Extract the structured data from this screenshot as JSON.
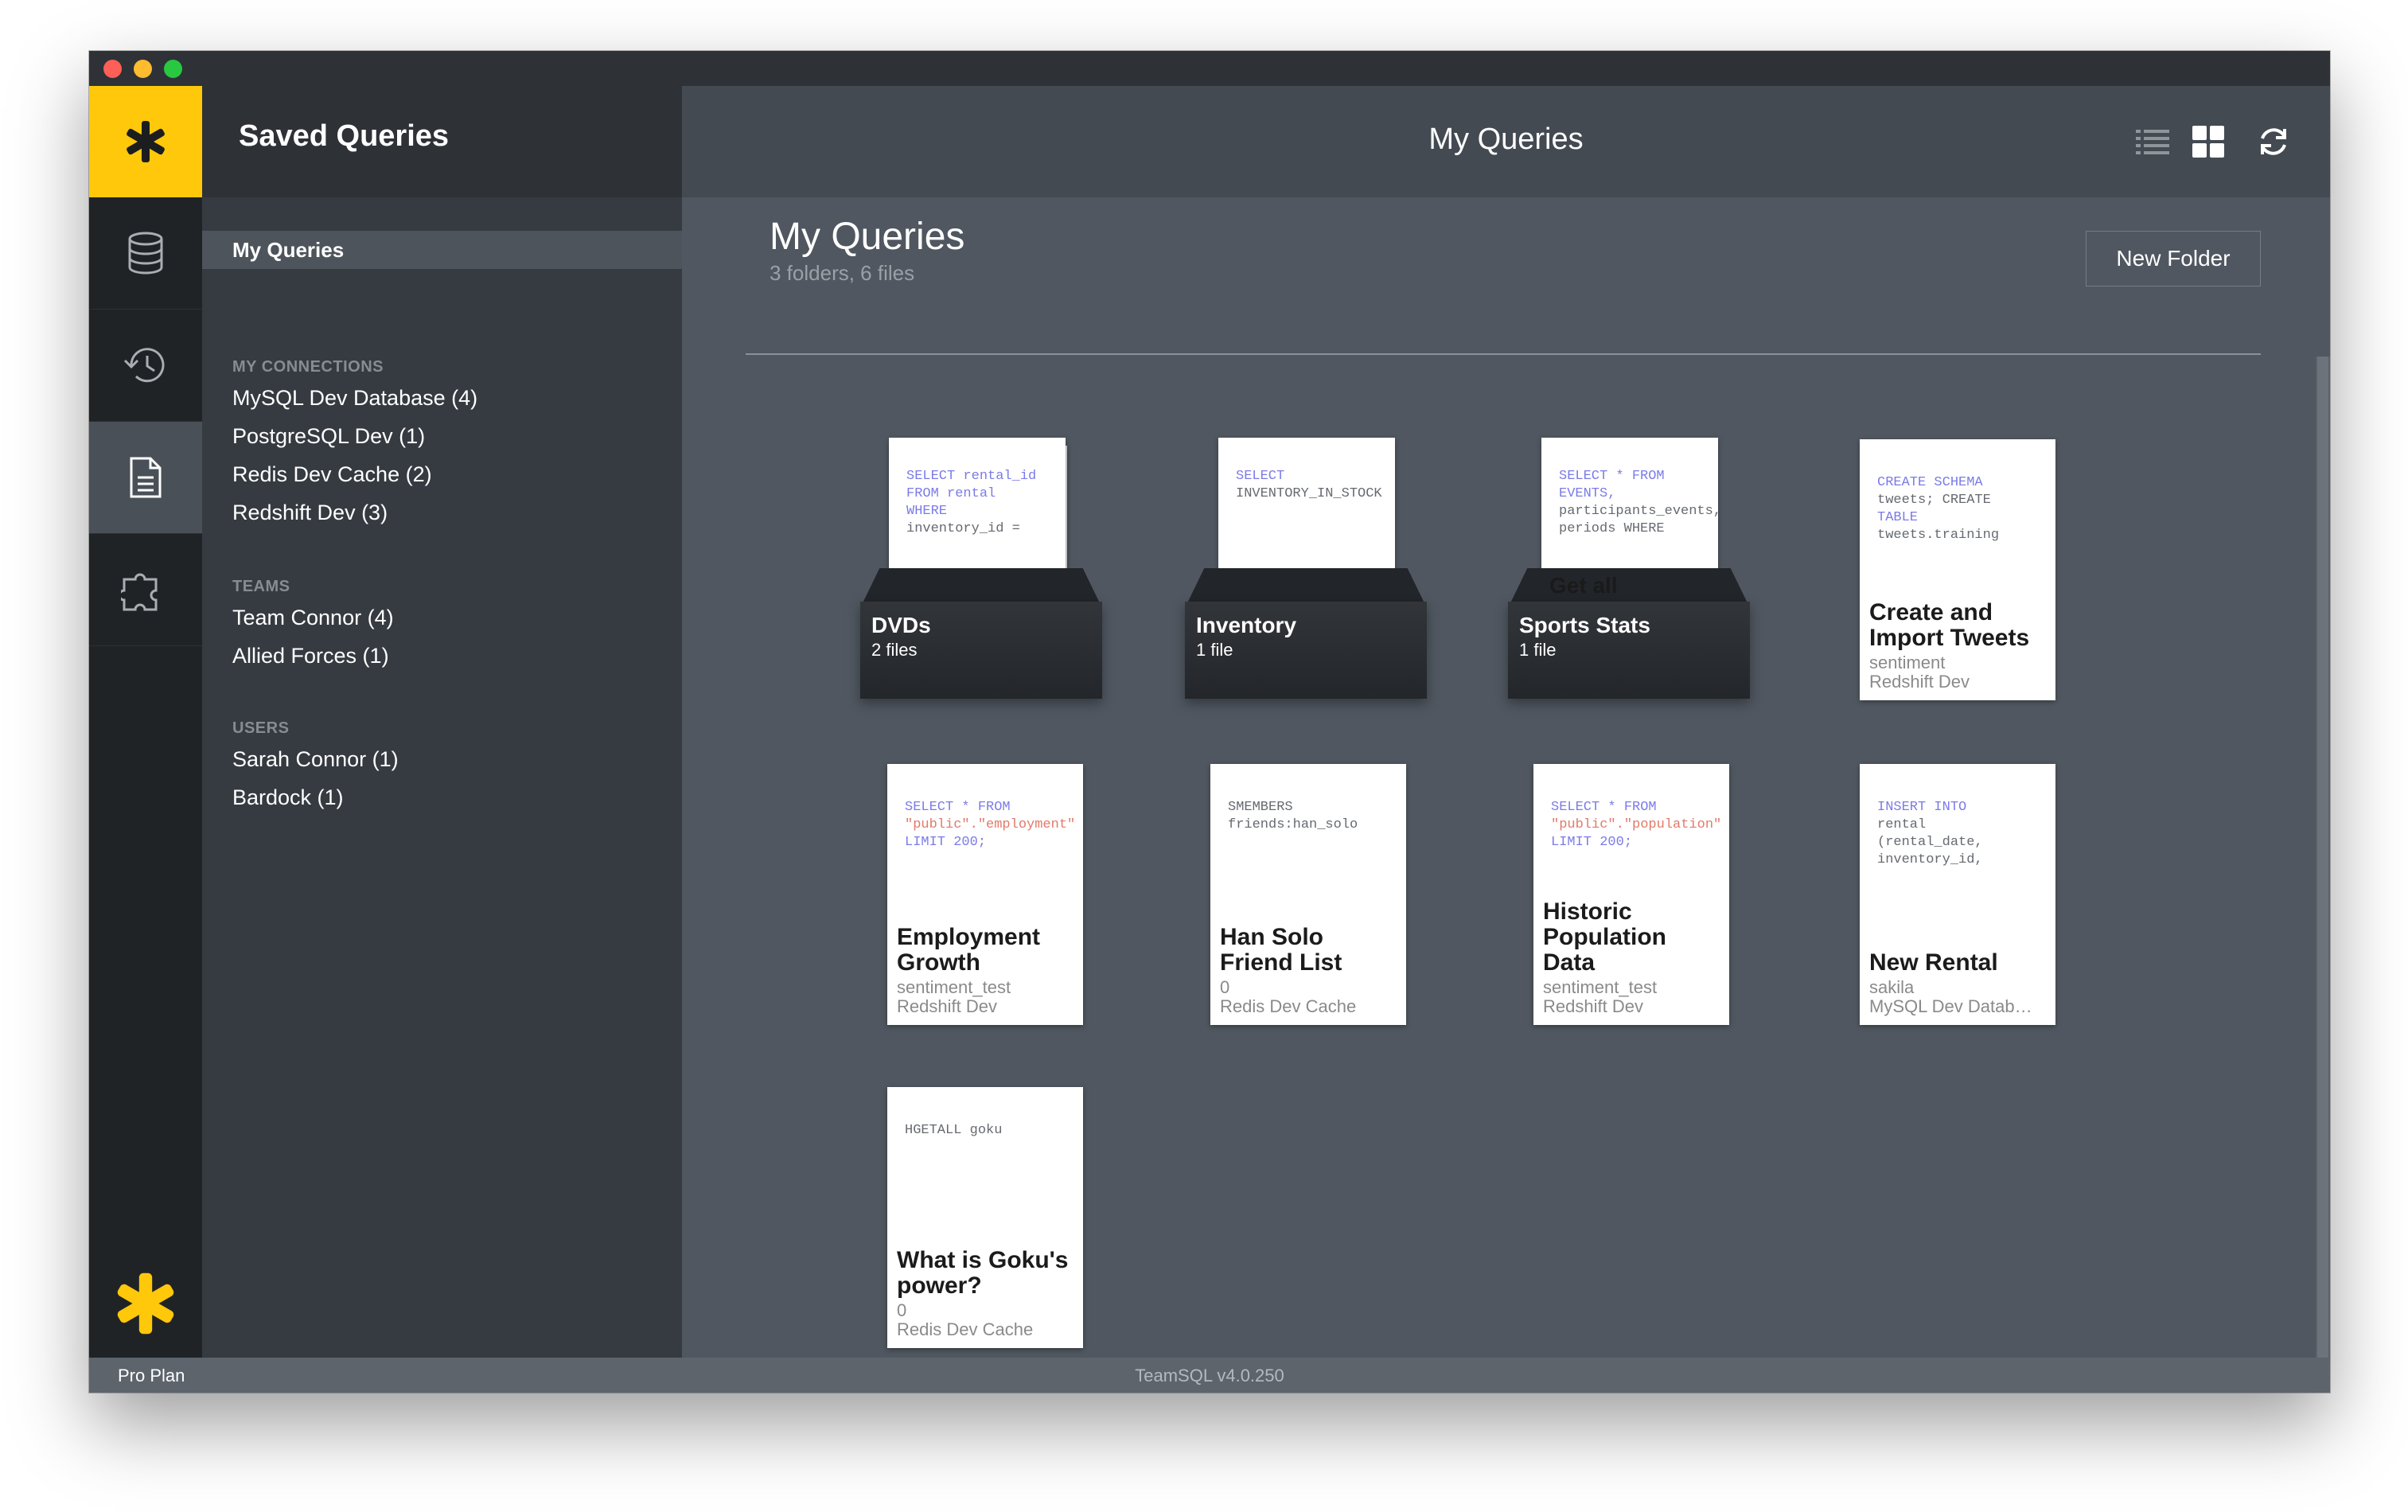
{
  "window": {
    "traffic_lights": [
      "close",
      "minimize",
      "zoom"
    ]
  },
  "rail": {
    "items": [
      {
        "name": "connections",
        "icon": "database-icon"
      },
      {
        "name": "history",
        "icon": "history-icon"
      },
      {
        "name": "saved-queries",
        "icon": "document-icon",
        "active": true
      },
      {
        "name": "plugins",
        "icon": "puzzle-icon"
      }
    ],
    "accent": "#ffc80a"
  },
  "sidebar": {
    "title": "Saved Queries",
    "active_item": "My Queries",
    "sections": [
      {
        "heading": "MY CONNECTIONS",
        "items": [
          "MySQL Dev Database (4)",
          "PostgreSQL Dev (1)",
          "Redis Dev Cache (2)",
          "Redshift Dev (3)"
        ]
      },
      {
        "heading": "TEAMS",
        "items": [
          "Team Connor (4)",
          "Allied Forces (1)"
        ]
      },
      {
        "heading": "USERS",
        "items": [
          "Sarah Connor (1)",
          "Bardock (1)"
        ]
      }
    ]
  },
  "header": {
    "title": "My Queries",
    "view_modes": [
      "list-view-icon",
      "grid-view-icon"
    ],
    "refresh_icon": "refresh-icon"
  },
  "main": {
    "title": "My Queries",
    "subtitle": "3 folders, 6 files",
    "new_folder_label": "New Folder",
    "folders": [
      {
        "name": "DVDs",
        "count": "2 files",
        "code": [
          "SELECT rental_id",
          "FROM rental",
          "WHERE",
          "inventory_id ="
        ]
      },
      {
        "name": "Inventory",
        "count": "1 file",
        "code": [
          "SELECT",
          "INVENTORY_IN_STOCK"
        ]
      },
      {
        "name": "Sports Stats",
        "count": "1 file",
        "peek": "Get all",
        "code": [
          "SELECT * FROM",
          "EVENTS,",
          "participants_events,",
          "periods WHERE"
        ]
      }
    ],
    "files": [
      {
        "name": "Create and Import Tweets",
        "database": "sentiment",
        "connection": "Redshift Dev",
        "code": [
          "CREATE SCHEMA",
          "tweets; CREATE",
          "TABLE",
          "tweets.training"
        ]
      },
      {
        "name": "Employment Growth",
        "database": "sentiment_test",
        "connection": "Redshift Dev",
        "code": [
          "SELECT * FROM",
          "\"public\".\"employment\"",
          "LIMIT 200;"
        ]
      },
      {
        "name": "Han Solo Friend List",
        "database": "0",
        "connection": "Redis Dev Cache",
        "code": [
          "SMEMBERS",
          "friends:han_solo"
        ]
      },
      {
        "name": "Historic Population Data",
        "database": "sentiment_test",
        "connection": "Redshift Dev",
        "code": [
          "SELECT * FROM",
          "\"public\".\"population\"",
          "LIMIT 200;"
        ]
      },
      {
        "name": "New Rental",
        "database": "sakila",
        "connection": "MySQL Dev Datab…",
        "code": [
          "INSERT INTO",
          "rental",
          "(rental_date,",
          "inventory_id,"
        ]
      },
      {
        "name": "What is Goku's power?",
        "database": "0",
        "connection": "Redis Dev Cache",
        "code": [
          "HGETALL goku"
        ]
      }
    ]
  },
  "status": {
    "plan": "Pro Plan",
    "version": "TeamSQL v4.0.250"
  }
}
